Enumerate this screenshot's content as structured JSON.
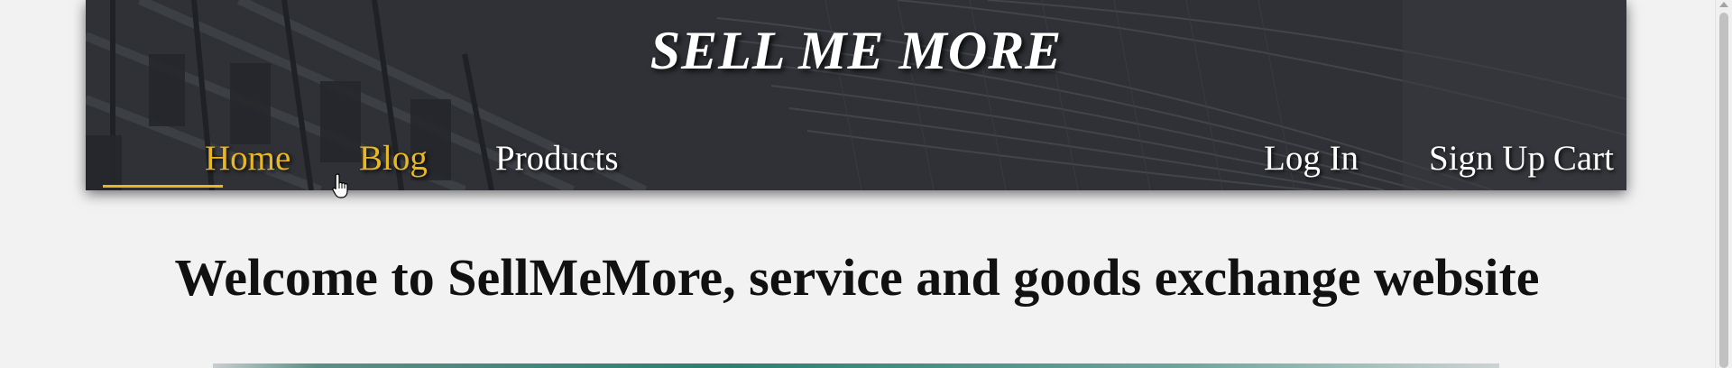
{
  "brand": {
    "title": "SELL ME MORE"
  },
  "nav": {
    "left": [
      {
        "label": "Home",
        "state": "active"
      },
      {
        "label": "Blog",
        "state": "hover"
      },
      {
        "label": "Products",
        "state": "normal"
      }
    ],
    "right": [
      {
        "label": "Log In"
      },
      {
        "label": "Sign Up"
      },
      {
        "label": "Cart"
      }
    ]
  },
  "main": {
    "heading": "Welcome to SellMeMore, service and goods exchange website"
  },
  "colors": {
    "header_bg": "#2e3034",
    "accent": "#e8b722",
    "page_bg": "#f2f2f2",
    "nav_text": "#ffffff"
  },
  "icons": {
    "cursor": "hand-pointer-icon",
    "scroll_up": "scroll-up-arrow-icon"
  }
}
